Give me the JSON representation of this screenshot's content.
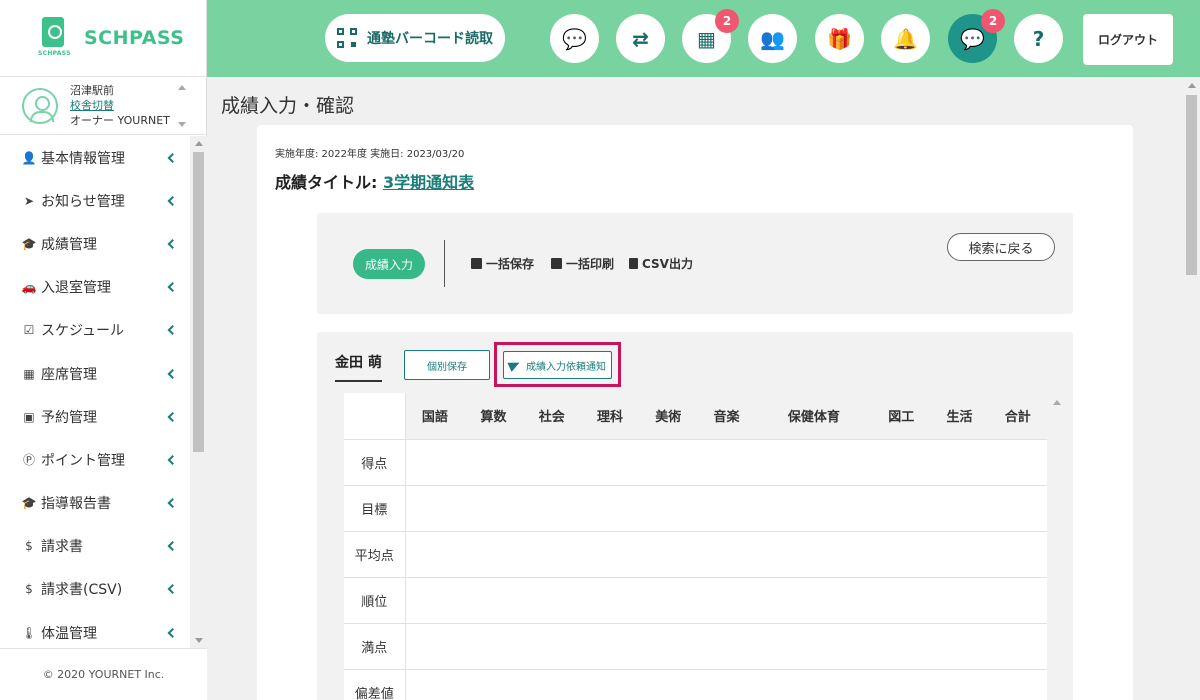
{
  "brand": {
    "name": "SCHPASS",
    "sub": "SCHPASS"
  },
  "school": {
    "name": "沼津駅前",
    "switch_link": "校舎切替",
    "role": "オーナー YOURNET"
  },
  "sidebar": {
    "items": [
      {
        "label": "基本情報管理",
        "icon": "user-icon",
        "glyph": "👤"
      },
      {
        "label": "お知らせ管理",
        "icon": "paper-plane-icon",
        "glyph": "➤"
      },
      {
        "label": "成績管理",
        "icon": "graduation-cap-icon",
        "glyph": "🎓"
      },
      {
        "label": "入退室管理",
        "icon": "car-icon",
        "glyph": "🚗"
      },
      {
        "label": "スケジュール",
        "icon": "calendar-check-icon",
        "glyph": "☑"
      },
      {
        "label": "座席管理",
        "icon": "calendar-grid-icon",
        "glyph": "▦"
      },
      {
        "label": "予約管理",
        "icon": "chalkboard-icon",
        "glyph": "▣"
      },
      {
        "label": "ポイント管理",
        "icon": "point-icon",
        "glyph": "Ⓟ"
      },
      {
        "label": "指導報告書",
        "icon": "graduation-cap-icon",
        "glyph": "🎓"
      },
      {
        "label": "請求書",
        "icon": "invoice-icon",
        "glyph": "$"
      },
      {
        "label": "請求書(CSV)",
        "icon": "invoice-icon",
        "glyph": "$"
      },
      {
        "label": "体温管理",
        "icon": "thermometer-icon",
        "glyph": "🌡"
      }
    ]
  },
  "copyright": "© 2020 YOURNET Inc.",
  "header": {
    "barcode_label": "通塾バーコード読取",
    "logout_label": "ログアウト",
    "icons": [
      {
        "name": "chat-icon",
        "glyph": "💬",
        "badge": ""
      },
      {
        "name": "exchange-icon",
        "glyph": "⇄",
        "badge": ""
      },
      {
        "name": "calendar-icon",
        "glyph": "▦",
        "badge": "2"
      },
      {
        "name": "meeting-icon",
        "glyph": "👥",
        "badge": ""
      },
      {
        "name": "gift-icon",
        "glyph": "🎁",
        "badge": ""
      },
      {
        "name": "bell-icon",
        "glyph": "🔔",
        "badge": ""
      },
      {
        "name": "message-icon",
        "glyph": "💬",
        "badge": "2"
      },
      {
        "name": "help-icon",
        "glyph": "?",
        "badge": ""
      }
    ]
  },
  "page": {
    "title": "成績入力・確認",
    "meta": "実施年度: 2022年度 実施日: 2023/03/20",
    "grade_title_label": "成績タイトル:",
    "grade_title_value": "3学期通知表"
  },
  "toolbar": {
    "input_label": "成績入力",
    "bulk_save": "一括保存",
    "bulk_print": "一括印刷",
    "csv_export": "CSV出力",
    "back_label": "検索に戻る"
  },
  "student": {
    "name": "金田 萌",
    "save_label": "個別保存",
    "request_label": "成績入力依頼通知"
  },
  "table": {
    "subjects": [
      "国語",
      "算数",
      "社会",
      "理科",
      "美術",
      "音楽",
      "保健体育",
      "図工",
      "生活",
      "合計"
    ],
    "rows": [
      "得点",
      "目標",
      "平均点",
      "順位",
      "満点",
      "偏差値"
    ]
  }
}
